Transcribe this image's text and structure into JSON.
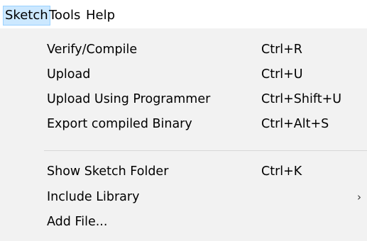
{
  "menubar": {
    "items": [
      {
        "label": "Sketch",
        "active": true
      },
      {
        "label": "Tools",
        "active": false
      },
      {
        "label": "Help",
        "active": false
      }
    ]
  },
  "dropdown": {
    "items": [
      {
        "label": "Verify/Compile",
        "shortcut": "Ctrl+R"
      },
      {
        "label": "Upload",
        "shortcut": "Ctrl+U"
      },
      {
        "label": "Upload Using Programmer",
        "shortcut": "Ctrl+Shift+U"
      },
      {
        "label": "Export compiled Binary",
        "shortcut": "Ctrl+Alt+S"
      },
      {
        "label": "Show Sketch Folder",
        "shortcut": "Ctrl+K"
      },
      {
        "label": "Include Library",
        "submenu_icon": "chevron-right-icon"
      },
      {
        "label": "Add File..."
      }
    ]
  },
  "colors": {
    "menu_background": "#f2f2f2",
    "active_highlight": "#cce8ff",
    "active_border": "#99d1ff"
  }
}
